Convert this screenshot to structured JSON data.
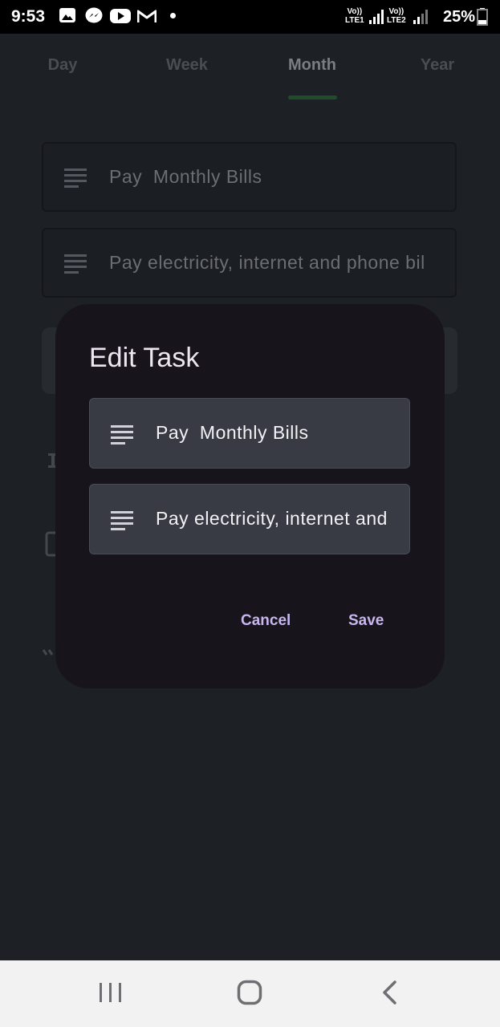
{
  "status_bar": {
    "time": "9:53",
    "lte1": [
      "Vo))",
      "LTE1"
    ],
    "lte2": [
      "Vo))",
      "LTE2"
    ],
    "battery": "25%"
  },
  "tabs": [
    "Day",
    "Week",
    "Month",
    "Year"
  ],
  "active_tab": "Month",
  "background": {
    "title_value": "Pay  Monthly Bills",
    "description_value": "Pay electricity, internet and phone bil"
  },
  "dialog": {
    "title": "Edit Task",
    "title_field_value": "Pay  Monthly Bills",
    "description_field_value": "Pay electricity, internet and",
    "cancel_label": "Cancel",
    "save_label": "Save"
  },
  "colors": {
    "dialog_bg": "#18141c",
    "field_bg": "#383b44",
    "accent": "#c8b6f0",
    "indicator": "#1f4d2a"
  },
  "icons": [
    "image-icon",
    "messenger-icon",
    "youtube-icon",
    "gmail-icon",
    "notes-icon",
    "signal-icon",
    "battery-icon",
    "recents-icon",
    "home-icon",
    "back-icon"
  ]
}
